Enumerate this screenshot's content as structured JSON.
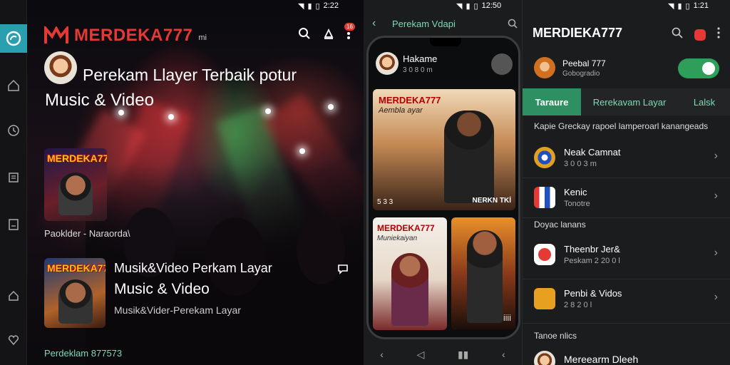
{
  "status_bar": {
    "left_time": "2:22",
    "mid_time": "12:50",
    "right_time": "1:21"
  },
  "left": {
    "brand": "MERDEKA777",
    "brand_suffix": "mi",
    "notification_count": "16",
    "headline": "Perekam Llayer Terbaik potur",
    "headline_line2": "Music & Video",
    "poster1_title": "MERDEKA777",
    "poster1_caption": "Paoklder - Naraorda\\",
    "poster2_title": "MERDEKA777",
    "item_title": "Musik&Video Perkam Layar",
    "item_title2": "Music & Video",
    "item_sub": "Musik&Vider-Perekam Layar",
    "footer": "Perdeklam 877573",
    "rail_icons": [
      "app-logo-icon",
      "home-icon",
      "history-icon",
      "library-icon",
      "document-icon",
      "house-icon",
      "heart-icon"
    ]
  },
  "middle": {
    "title": "Perekam Vdapi",
    "profile_name": "Hakame",
    "profile_sub": "3 0 8 0 m",
    "card1_title": "MERDEKA777",
    "card1_subtitle": "Aembla ayar",
    "card1_watermark": "NERKN TKİ",
    "card1_tag": "5 3 3",
    "card2_title": "MERDEKA777",
    "card2_subtitle": "Muniekaiyan",
    "card3_badge": "İİİİ"
  },
  "right": {
    "title": "MERDIEKA777",
    "profile_name": "Peebal 777",
    "profile_sub": "Gobogradio",
    "tabs": [
      {
        "label": "Taraure",
        "active": true
      },
      {
        "label": "Rerekavam Layar",
        "active": false
      },
      {
        "label": "Lalsk",
        "active": false
      }
    ],
    "section1": "Kapie Greckay rapoel lamperoarl kanangeads",
    "rows_a": [
      {
        "t1": "Neak Camnat",
        "t2": "3 0 0 3 m"
      },
      {
        "t1": "Kenic",
        "t2": "Tonotre"
      }
    ],
    "section2": "Doyac lanans",
    "rows_b": [
      {
        "t1": "Theenbr Jer&",
        "t2": "Peskam 2 20 0 l"
      },
      {
        "t1": "Penbi & Vidos",
        "t2": "2 8 2 0 l"
      }
    ],
    "section3": "Tanoe nlics",
    "last_row": "Mereearm Dleeh"
  },
  "colors": {
    "brand_red": "#e53935",
    "accent_green": "#2e8f62",
    "teal": "#2a9fb0"
  }
}
